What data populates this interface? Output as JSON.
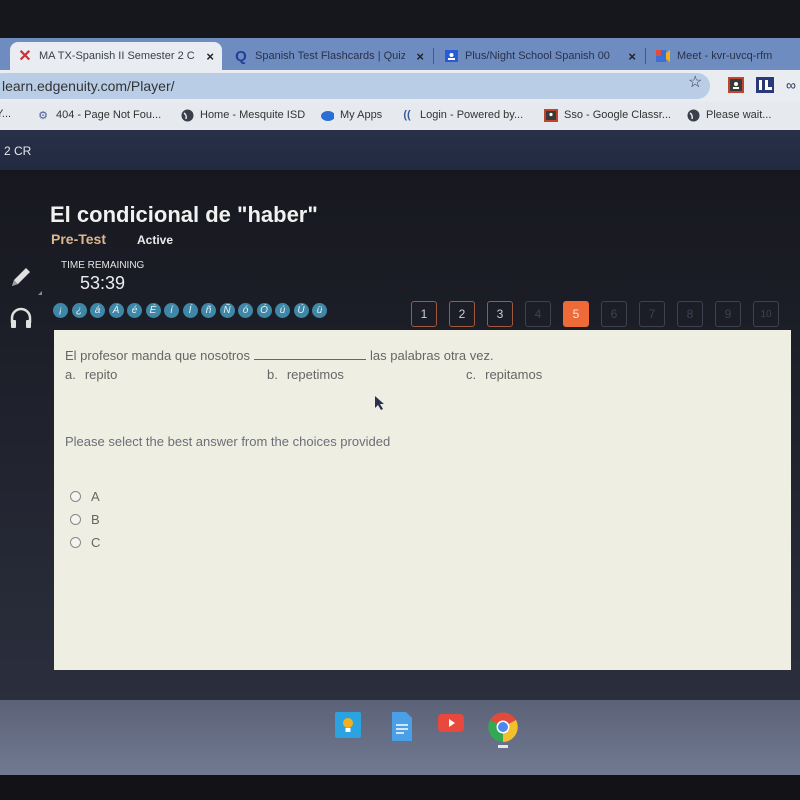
{
  "browser": {
    "tabs": [
      {
        "label": "MA TX-Spanish II Semester 2 C",
        "icon": "edgenuity-x-icon",
        "active": true
      },
      {
        "label": "Spanish Test Flashcards | Quiz",
        "icon": "quizlet-icon",
        "active": false
      },
      {
        "label": "Plus/Night School Spanish 00",
        "icon": "classroom-icon",
        "active": false
      },
      {
        "label": "Meet - kvr-uvcq-rfm",
        "icon": "meet-icon",
        "active": false
      }
    ],
    "close_glyph": "×",
    "address": "learn.edgenuity.com/Player/",
    "bookmarks": [
      {
        "label": "Y...",
        "icon": "page-icon"
      },
      {
        "label": "404 - Page Not Fou...",
        "icon": "robot-icon"
      },
      {
        "label": "Home - Mesquite ISD",
        "icon": "globe-icon"
      },
      {
        "label": "My Apps",
        "icon": "cloud-icon"
      },
      {
        "label": "Login - Powered by...",
        "icon": "wifi-logo-icon"
      },
      {
        "label": "Sso - Google Classr...",
        "icon": "classroom-icon"
      },
      {
        "label": "Please wait...",
        "icon": "globe-icon"
      }
    ]
  },
  "course": {
    "bar_label": "2 CR",
    "lesson_title": "El condicional de \"haber\"",
    "assessment_type": "Pre-Test",
    "status": "Active",
    "time_label": "TIME REMAINING",
    "time_value": "53:39"
  },
  "accent_buttons": [
    "¡",
    "¿",
    "á",
    "Á",
    "é",
    "É",
    "í",
    "Í",
    "ñ",
    "Ñ",
    "ó",
    "Ó",
    "ú",
    "Ú",
    "ü"
  ],
  "question_nav": {
    "questions": [
      {
        "label": "1",
        "state": "answered"
      },
      {
        "label": "2",
        "state": "answered"
      },
      {
        "label": "3",
        "state": "answered"
      },
      {
        "label": "4",
        "state": "disabled"
      },
      {
        "label": "5",
        "state": "current"
      },
      {
        "label": "6",
        "state": "disabled"
      },
      {
        "label": "7",
        "state": "disabled"
      },
      {
        "label": "8",
        "state": "disabled"
      },
      {
        "label": "9",
        "state": "disabled"
      },
      {
        "label": "10",
        "state": "disabled"
      }
    ],
    "current_color": "#ee6a39"
  },
  "question": {
    "text_before": "El profesor manda que nosotros",
    "text_after": "las palabras otra vez.",
    "choices": [
      {
        "letter": "a.",
        "text": "repito"
      },
      {
        "letter": "b.",
        "text": "repetimos"
      },
      {
        "letter": "c.",
        "text": "repitamos"
      }
    ],
    "instruction": "Please select the best answer from the choices provided",
    "options": [
      "A",
      "B",
      "C"
    ]
  },
  "shelf": {
    "apps": [
      "keep-icon",
      "docs-icon",
      "youtube-icon",
      "chrome-icon"
    ]
  }
}
